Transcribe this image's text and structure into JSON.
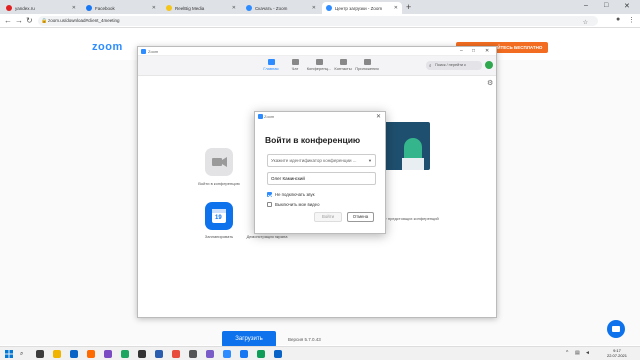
{
  "browser": {
    "tabs": [
      {
        "title": "yandex.ru",
        "fav_color": "#e02020",
        "active": false
      },
      {
        "title": "Facebook",
        "fav_color": "#1877f2",
        "active": false
      },
      {
        "title": "ReelBig Media",
        "fav_color": "#f5c518",
        "active": false
      },
      {
        "title": "Скачать - Zoom",
        "fav_color": "#2d8cff",
        "active": false
      },
      {
        "title": "Центр загрузки - Zoom",
        "fav_color": "#2d8cff",
        "active": true
      }
    ],
    "new_tab": "+",
    "url": "zoom.us/download#client_4meeting"
  },
  "site": {
    "logo": "zoom",
    "cta": "ЗАРЕГИСТРИРУЙТЕСЬ БЕСПЛАТНО",
    "download_button": "Загрузить",
    "version": "Версия 5.7.0.43"
  },
  "app": {
    "title": "Zoom",
    "tabs": [
      {
        "label": "Главная",
        "active": true
      },
      {
        "label": "Чат",
        "active": false
      },
      {
        "label": "Конференц...",
        "active": false
      },
      {
        "label": "Контакты",
        "active": false
      },
      {
        "label": "Приложения",
        "active": false
      }
    ],
    "search_placeholder": "Поиск / перейти к",
    "home": {
      "join_label": "Войти в конференцию",
      "schedule_label": "Запланировать",
      "schedule_day": "19",
      "screen_share_label": "Демонстрация экрана",
      "no_meetings": "Нет предстоящих конференций"
    }
  },
  "dialog": {
    "title": "Zoom",
    "heading": "Войти в конференцию",
    "meeting_id_placeholder": "Укажите идентификатор конференции ...",
    "name_value": "Олег Каминский",
    "options": [
      {
        "label": "Не подключать звук",
        "checked": true
      },
      {
        "label": "Выключить мое видео",
        "checked": false
      }
    ],
    "join_button": "Войти",
    "cancel_button": "Отмена"
  },
  "taskbar": {
    "time": "9:17",
    "date": "22.07.2021"
  }
}
